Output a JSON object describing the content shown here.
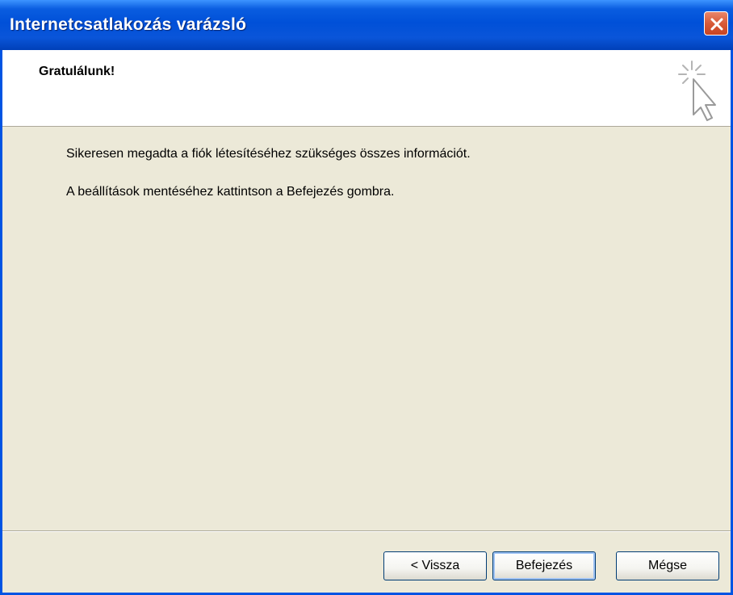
{
  "window": {
    "title": "Internetcsatlakozás varázsló"
  },
  "header": {
    "heading": "Gratulálunk!",
    "icon": "wizard-cursor-icon"
  },
  "body": {
    "line1": "Sikeresen megadta a fiók létesítéséhez szükséges összes információt.",
    "line2": "A beállítások mentéséhez kattintson a Befejezés gombra."
  },
  "buttons": {
    "back": "< Vissza",
    "finish": "Befejezés",
    "cancel": "Mégse"
  },
  "colors": {
    "titlebar": "#0a5de0",
    "close": "#d85a38",
    "dialog_bg": "#ece9d8"
  }
}
